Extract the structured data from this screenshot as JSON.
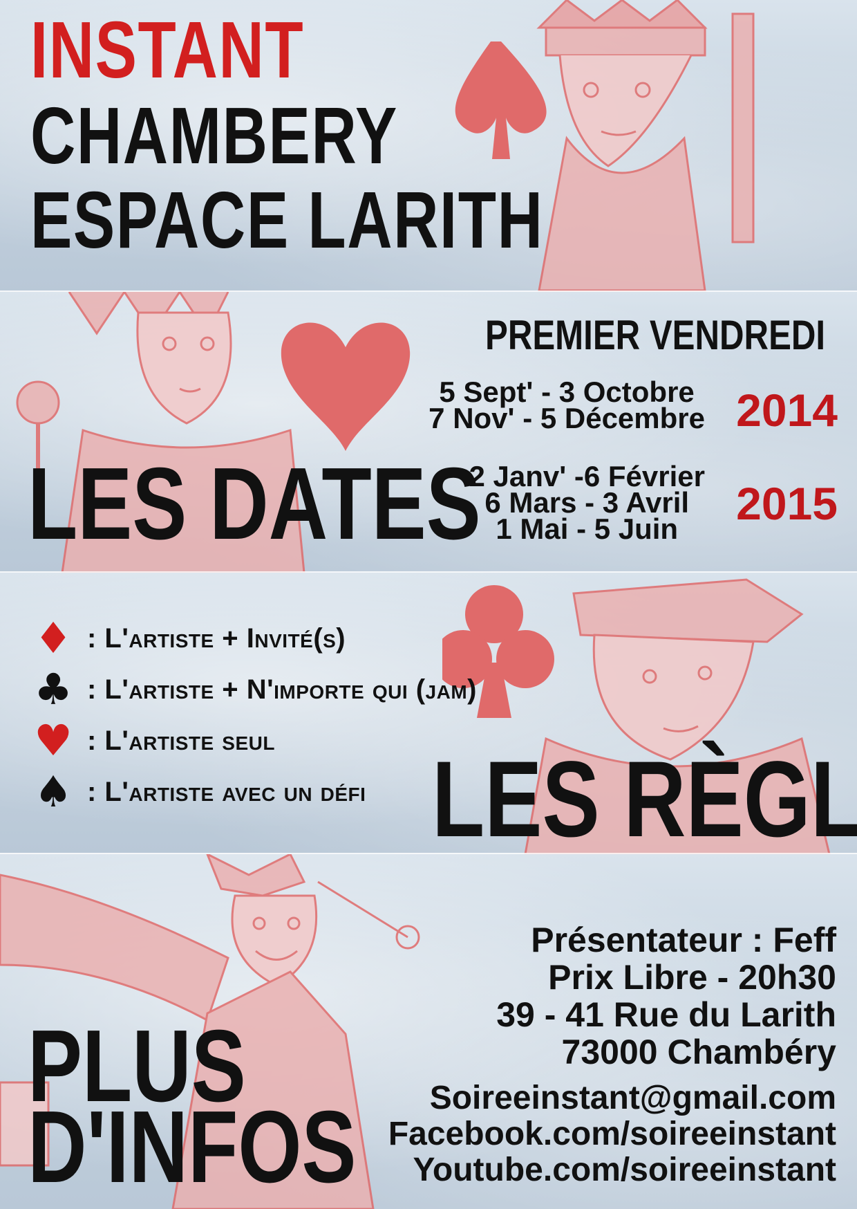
{
  "header": {
    "title_line1": "INSTANT",
    "title_line2": "CHAMBERY",
    "title_line3": "ESPACE LARITH"
  },
  "dates": {
    "subtitle": "PREMIER VENDREDI",
    "heading": "LES DATES",
    "group_2014": {
      "year": "2014",
      "lines": [
        "5 Sept' - 3 Octobre",
        "7 Nov' - 5 Décembre"
      ]
    },
    "group_2015": {
      "year": "2015",
      "lines": [
        "2 Janv' -6 Février",
        "6 Mars - 3 Avril",
        "1 Mai - 5 Juin"
      ]
    }
  },
  "rules": {
    "heading": "LES RÈGLES",
    "items": [
      {
        "suit": "diamond",
        "color": "red",
        "text": ": L'artiste + Invité(s)"
      },
      {
        "suit": "club",
        "color": "black",
        "text": ": L'artiste + N'importe qui (jam)"
      },
      {
        "suit": "heart",
        "color": "red",
        "text": ": L'artiste seul"
      },
      {
        "suit": "spade",
        "color": "black",
        "text": ": L'artiste avec un défi"
      }
    ]
  },
  "infos": {
    "heading_line1": "PLUS",
    "heading_line2": "D'INFOS",
    "details": [
      "Présentateur : Feff",
      "Prix Libre - 20h30",
      "39 - 41 Rue du Larith",
      "73000 Chambéry"
    ],
    "contacts": [
      "Soireeinstant@gmail.com",
      "Facebook.com/soireeinstant",
      "Youtube.com/soireeinstant"
    ]
  },
  "colors": {
    "accent_red": "#d21f1f",
    "text_black": "#111111",
    "art_red": "#e06a6a"
  }
}
